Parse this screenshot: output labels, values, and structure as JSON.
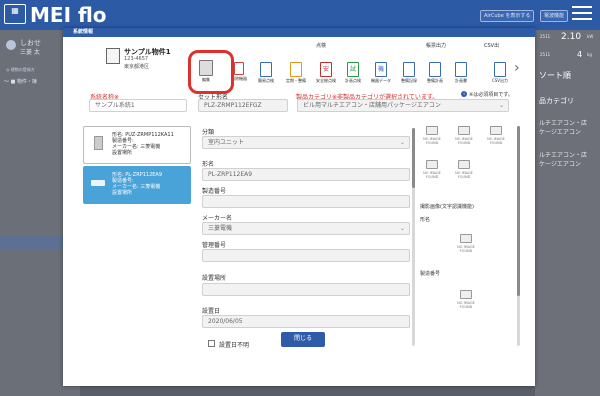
{
  "app": {
    "logo_icon": "building-logo-icon",
    "logo_caption": "",
    "title": "MEI flo",
    "header_buttons": [
      "AirCube を表示する",
      "電波機能"
    ],
    "menu_icon": "hamburger-menu-icon"
  },
  "background_left": {
    "user_line1": "しおせ",
    "user_line2": "三菱 太",
    "link": "◎ 建物の登録方",
    "tree_row": "〜 ■ 物件・棟"
  },
  "background_right": {
    "row1_small": "2511",
    "row1_value": "2.10",
    "row1_unit": "kW",
    "row2_small": "2511",
    "row2_value": "4",
    "row2_unit": "kg",
    "sort": "ソート順",
    "category_header": "品カテゴリ",
    "cat1a": "ルチエアコン・店",
    "cat1b": "ケージエアコン",
    "cat2a": "ルチエアコン・店",
    "cat2b": "ケージエアコン"
  },
  "modal": {
    "title": "系統情報",
    "property": {
      "name": "サンプル物件1",
      "zip": "123-4657",
      "address": "東京都港区"
    },
    "toolbar": {
      "group_inspect": "点検",
      "group_ledger": "帳票出力",
      "group_csv": "CSV出",
      "tools": [
        {
          "label": "編集",
          "icon": "edit-pencil-icon"
        },
        {
          "label": "削除機器",
          "icon": "delete-device-icon"
        },
        {
          "label": "簡易点検",
          "icon": "simple-inspection-icon"
        },
        {
          "label": "定期・整備",
          "icon": "periodic-inspection-icon"
        },
        {
          "label": "安全総点検",
          "icon": "safety-inspection-icon"
        },
        {
          "label": "計画点検",
          "icon": "planned-inspection-icon"
        },
        {
          "label": "機器データ",
          "icon": "device-data-icon"
        },
        {
          "label": "整備記録",
          "icon": "maintenance-record-icon"
        },
        {
          "label": "整備計画",
          "icon": "maintenance-plan-icon"
        },
        {
          "label": "計画書",
          "icon": "plan-document-icon"
        },
        {
          "label": "CSV出力",
          "icon": "csv-export-icon"
        }
      ]
    },
    "system_name_label": "系統名称※",
    "system_name_value": "サンプル系統1",
    "set_model_label": "セット形名",
    "set_model_value": "PLZ-ZRMP112EFGZ",
    "category_label": "製品カテゴリ※非製品カテゴリが選択されています。",
    "required_note": "※は必須項目です。",
    "category_value": "ビル用マルチエアコン・店舗用パッケージエアコン",
    "devices": [
      {
        "model": "形名: PUZ-ZRMP112KA11",
        "serial": "製造番号:",
        "maker": "メーカー名: 三菱電機",
        "place": "設置場所"
      },
      {
        "model": "形名: PL-ZRP112EA9",
        "serial": "製造番号:",
        "maker": "メーカー名: 三菱電機",
        "place": "設置場所"
      }
    ],
    "form": {
      "class_label": "分類",
      "class_value": "室内ユニット",
      "model_label": "形名",
      "model_value": "PL-ZRP112EA9",
      "serial_label": "製造番号",
      "serial_value": "",
      "maker_label": "メーカー名",
      "maker_value": "三菱電機",
      "mgmt_label": "管理番号",
      "mgmt_value": "",
      "place_label": "設置場所",
      "place_value": "",
      "date_label": "設置日",
      "date_value": "2020/06/05",
      "date_unknown": "設置日不明"
    },
    "images": {
      "noimage_line1": "NO IMAGE",
      "noimage_line2": "FOUND",
      "label_photo": "撮影画像(文字認識機能)",
      "label_model": "形名",
      "label_serial": "製造番号"
    },
    "close": "閉じる"
  }
}
